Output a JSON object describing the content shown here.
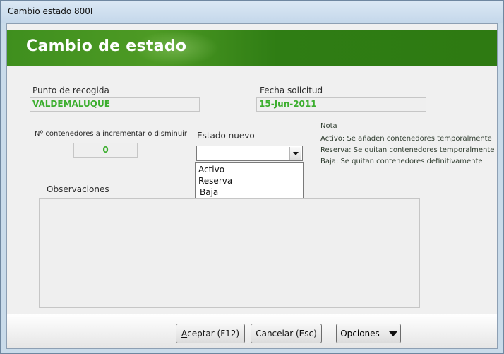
{
  "window": {
    "title": "Cambio estado 800I"
  },
  "header": {
    "title": "Cambio de estado"
  },
  "form": {
    "punto_label": "Punto de recogida",
    "punto_value": "VALDEMALUQUE",
    "fecha_label": "Fecha solicitud",
    "fecha_value": "15-Jun-2011",
    "contenedores_label": "Nº contenedores a incrementar o disminuir",
    "contenedores_value": "0",
    "estado_label": "Estado nuevo",
    "estado_value": "",
    "estado_options": [
      "Activo",
      "Reserva",
      "Baja"
    ],
    "observaciones_label": "Observaciones",
    "observaciones_value": ""
  },
  "nota": {
    "title": "Nota",
    "lines": [
      "Activo: Se añaden contenedores temporalmente",
      "Reserva: Se quitan contenedores temporalmente",
      "Baja: Se quitan contenedores definitivamente"
    ]
  },
  "buttons": {
    "aceptar_first": "A",
    "aceptar_rest": "ceptar (F12)",
    "cancelar": "Cancelar (Esc)",
    "opciones_first": "O",
    "opciones_rest": "pciones"
  },
  "colors": {
    "accent": "#3cae2e",
    "banner": "#3f8f1e"
  },
  "icons": {
    "combo_arrow": "chevron-down-icon",
    "split_arrow": "caret-down-icon"
  }
}
